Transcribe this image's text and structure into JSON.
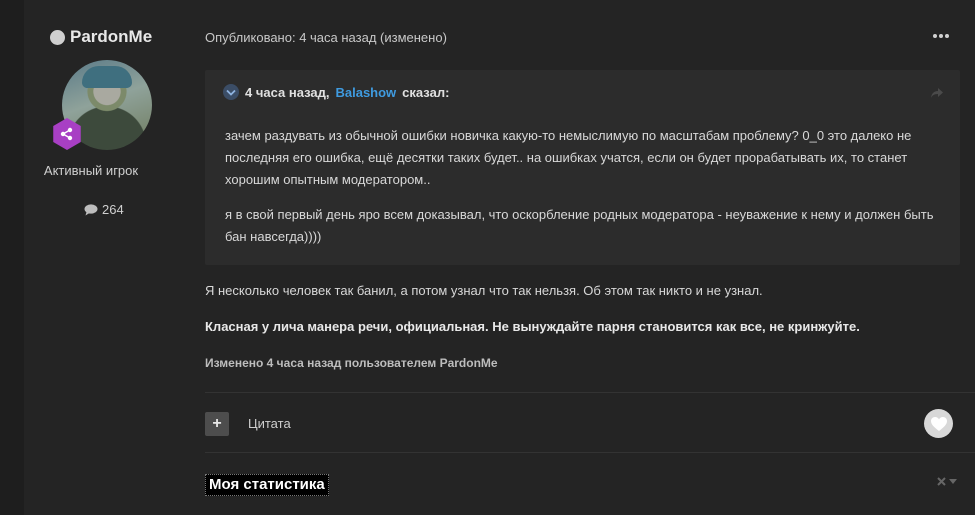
{
  "author": {
    "name": "PardonMe",
    "rank": "Активный игрок",
    "posts": "264",
    "icons": {
      "status": "online-dot",
      "rank": "share-nodes-icon",
      "posts": "comment-icon"
    }
  },
  "post": {
    "meta": "Опубликовано: 4 часа назад (изменено)",
    "quote": {
      "prefix": "4 часа назад,",
      "author": "Balashow",
      "suffix": "сказал:",
      "p1": "зачем раздувать из обычной ошибки новичка какую-то немыслимую по масштабам проблему? 0_0 это далеко не последняя его ошибка, ещё десятки таких будет.. на ошибках учатся, если он будет прорабатывать их, то станет хорошим опытным модератором..",
      "p2": "я в свой первый день яро всем доказывал, что оскорбление родных модератора - неуважение к нему и должен быть бан навсегда))))"
    },
    "body": {
      "p1": "Я несколько человек так банил, а потом узнал что так нельзя. Об этом так никто и не узнал.",
      "p2": "Класная у лича манера речи, официальная. Не вынуждайте парня становится как все, не кринжуйте."
    },
    "edited": "Изменено 4 часа назад пользователем PardonMe",
    "actions": {
      "plus": "+",
      "quote_label": "Цитата"
    },
    "signature_title": "Моя статистика"
  },
  "colors": {
    "link": "#3f9be0",
    "rank_badge": "#a83fc4",
    "background": "#1e1e1e",
    "panel": "#242424",
    "quote_bg": "#2c2c2c"
  }
}
